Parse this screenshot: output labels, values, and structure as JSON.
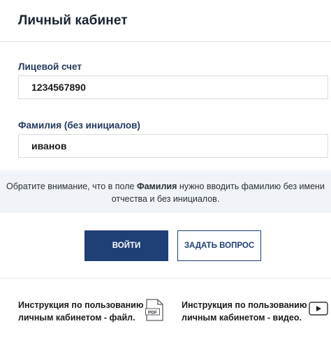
{
  "header": {
    "title": "Личный кабинет"
  },
  "account": {
    "label": "Лицевой счет",
    "value": "1234567890",
    "placeholder": ""
  },
  "surname": {
    "label": "Фамилия (без инициалов)",
    "value": "иванов",
    "placeholder": ""
  },
  "notice": {
    "part1": "Обратите внимание, что в поле ",
    "bold": "Фамилия",
    "part2": " нужно вводить фамилию без имени",
    "line2": "отчества и без инициалов."
  },
  "buttons": {
    "login": "ВОЙТИ",
    "ask": "ЗАДАТЬ ВОПРОС"
  },
  "instructions": {
    "file": {
      "line1": "Инструкция по пользованию",
      "line2": "личным кабинетом - файл.",
      "icon": "pdf-icon",
      "icon_text": "PDF"
    },
    "video": {
      "line1": "Инструкция по пользованию",
      "line2": "личным кабинетом - видео.",
      "icon": "video-play-icon"
    }
  },
  "colors": {
    "primary": "#1f3f77",
    "label": "#233a5e",
    "notice_bg": "#f0f3f7"
  }
}
